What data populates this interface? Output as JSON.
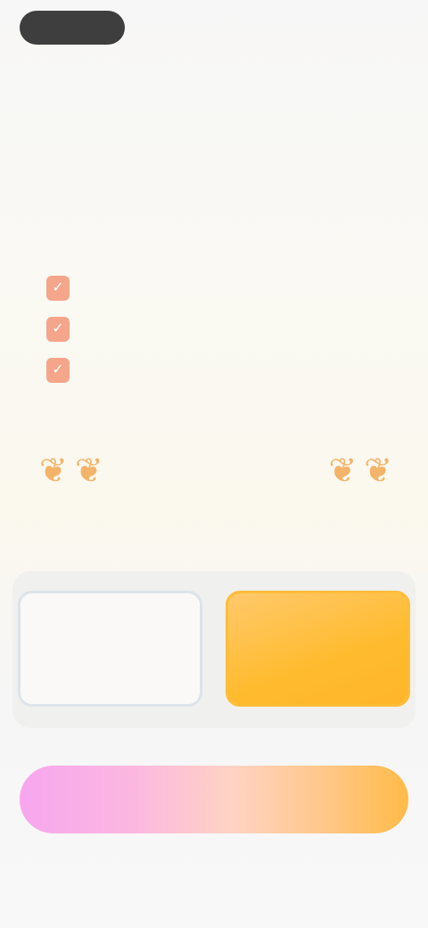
{
  "nav": {
    "back_label": ""
  },
  "brand": {
    "part1": "",
    "part2": "",
    "part3": ""
  },
  "headline": {
    "line1_dark": "",
    "line1_pink": "",
    "line2_dark": "",
    "line2_pink": ""
  },
  "features": [
    {
      "text": ""
    },
    {
      "text": ""
    },
    {
      "text": ""
    }
  ],
  "badges": [
    {
      "title": "",
      "subtitle": ""
    },
    {
      "title": "",
      "subtitle": ""
    }
  ],
  "plans": {
    "weekly": {
      "name": "",
      "price": ""
    },
    "annual": {
      "name": "",
      "price": ""
    }
  },
  "renew_note": "",
  "cta": {
    "label": ""
  },
  "footer": {
    "terms": "",
    "restore": "",
    "privacy": ""
  },
  "colors": {
    "accent_pink": "#ee9cf3",
    "accent_orange": "#ffbb2e",
    "check_color": "#f4a58a"
  }
}
